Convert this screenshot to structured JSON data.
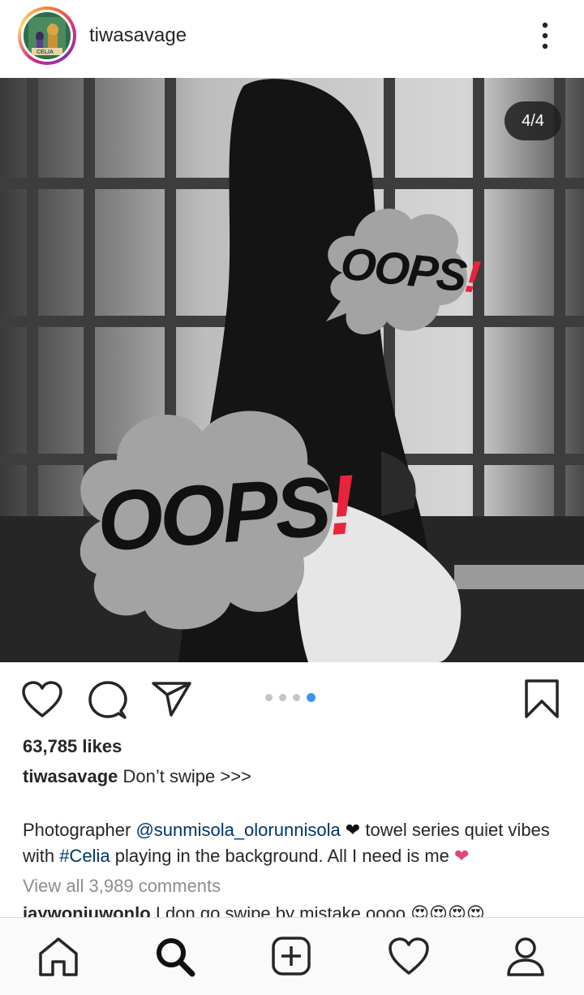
{
  "header": {
    "username": "tiwasavage",
    "avatar_text": "CELIA"
  },
  "post": {
    "counter": "4/4",
    "sticker_text": "OOPS",
    "sticker_mark": "!"
  },
  "carousel": {
    "total": 4,
    "active": 4
  },
  "likes": "63,785 likes",
  "caption": {
    "author": "tiwasavage",
    "headline": " Don’t swipe >>>",
    "line2_prefix": "Photographer ",
    "mention": "@sunmisola_olorunnisola",
    "heart1": " ❤",
    "line2_mid": " towel series quiet vibes with ",
    "hashtag": "#Celia",
    "line2_suffix": " playing in the background. All I need is me ",
    "heart2": "❤"
  },
  "view_comments": "View all 3,989 comments",
  "comment_peek": {
    "author": "iaywoniuwonlo",
    "text": " I don go swipe by mistake oooo 😍😍😍😍"
  },
  "colors": {
    "accent": "#3897f0",
    "link": "#003569",
    "sticker_red": "#e8243c",
    "heart_pink": "#e0457b"
  },
  "icons": [
    "more-vertical-icon",
    "heart-icon",
    "comment-icon",
    "share-icon",
    "bookmark-icon",
    "home-icon",
    "search-icon",
    "add-post-icon",
    "activity-heart-icon",
    "profile-icon"
  ]
}
